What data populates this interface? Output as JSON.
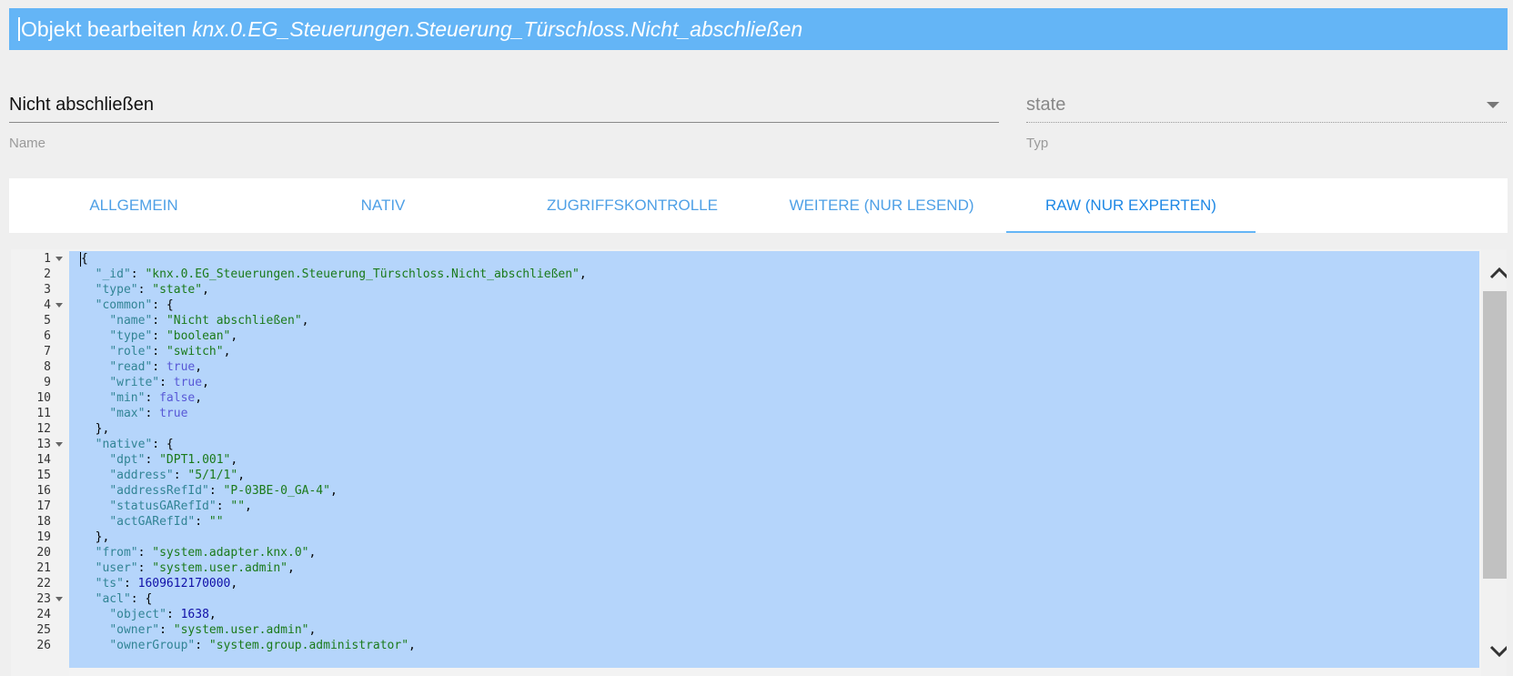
{
  "dialog": {
    "title_prefix": "Objekt bearbeiten",
    "object_id": "knx.0.EG_Steuerungen.Steuerung_Türschloss.Nicht_abschließen"
  },
  "form": {
    "name_value": "Nicht abschließen",
    "name_label": "Name",
    "type_value": "state",
    "type_label": "Typ"
  },
  "tabs": [
    {
      "label": "ALLGEMEIN",
      "active": false
    },
    {
      "label": "NATIV",
      "active": false
    },
    {
      "label": "ZUGRIFFSKONTROLLE",
      "active": false
    },
    {
      "label": "WEITERE (NUR LESEND)",
      "active": false
    },
    {
      "label": "RAW (NUR EXPERTEN)",
      "active": true
    }
  ],
  "colors": {
    "title_bar": "#64b5f6",
    "tab_text": "#4fa0e6",
    "active_tab": "#1e88e5",
    "selection": "#b5d5fb"
  },
  "editor": {
    "line_numbers": [
      "1",
      "2",
      "3",
      "4",
      "5",
      "6",
      "7",
      "8",
      "9",
      "10",
      "11",
      "12",
      "13",
      "14",
      "15",
      "16",
      "17",
      "18",
      "19",
      "20",
      "21",
      "22",
      "23",
      "24",
      "25",
      "26"
    ],
    "fold_lines": [
      "1",
      "4",
      "13",
      "23"
    ],
    "lines": [
      [
        {
          "t": "p",
          "v": "{"
        }
      ],
      [
        {
          "t": "p",
          "v": "  "
        },
        {
          "t": "k",
          "v": "\"_id\""
        },
        {
          "t": "p",
          "v": ": "
        },
        {
          "t": "s",
          "v": "\"knx.0.EG_Steuerungen.Steuerung_Türschloss.Nicht_abschließen\""
        },
        {
          "t": "p",
          "v": ","
        }
      ],
      [
        {
          "t": "p",
          "v": "  "
        },
        {
          "t": "k",
          "v": "\"type\""
        },
        {
          "t": "p",
          "v": ": "
        },
        {
          "t": "s",
          "v": "\"state\""
        },
        {
          "t": "p",
          "v": ","
        }
      ],
      [
        {
          "t": "p",
          "v": "  "
        },
        {
          "t": "k",
          "v": "\"common\""
        },
        {
          "t": "p",
          "v": ": {"
        }
      ],
      [
        {
          "t": "p",
          "v": "    "
        },
        {
          "t": "k",
          "v": "\"name\""
        },
        {
          "t": "p",
          "v": ": "
        },
        {
          "t": "s",
          "v": "\"Nicht abschließen\""
        },
        {
          "t": "p",
          "v": ","
        }
      ],
      [
        {
          "t": "p",
          "v": "    "
        },
        {
          "t": "k",
          "v": "\"type\""
        },
        {
          "t": "p",
          "v": ": "
        },
        {
          "t": "s",
          "v": "\"boolean\""
        },
        {
          "t": "p",
          "v": ","
        }
      ],
      [
        {
          "t": "p",
          "v": "    "
        },
        {
          "t": "k",
          "v": "\"role\""
        },
        {
          "t": "p",
          "v": ": "
        },
        {
          "t": "s",
          "v": "\"switch\""
        },
        {
          "t": "p",
          "v": ","
        }
      ],
      [
        {
          "t": "p",
          "v": "    "
        },
        {
          "t": "k",
          "v": "\"read\""
        },
        {
          "t": "p",
          "v": ": "
        },
        {
          "t": "b",
          "v": "true"
        },
        {
          "t": "p",
          "v": ","
        }
      ],
      [
        {
          "t": "p",
          "v": "    "
        },
        {
          "t": "k",
          "v": "\"write\""
        },
        {
          "t": "p",
          "v": ": "
        },
        {
          "t": "b",
          "v": "true"
        },
        {
          "t": "p",
          "v": ","
        }
      ],
      [
        {
          "t": "p",
          "v": "    "
        },
        {
          "t": "k",
          "v": "\"min\""
        },
        {
          "t": "p",
          "v": ": "
        },
        {
          "t": "b",
          "v": "false"
        },
        {
          "t": "p",
          "v": ","
        }
      ],
      [
        {
          "t": "p",
          "v": "    "
        },
        {
          "t": "k",
          "v": "\"max\""
        },
        {
          "t": "p",
          "v": ": "
        },
        {
          "t": "b",
          "v": "true"
        }
      ],
      [
        {
          "t": "p",
          "v": "  },"
        }
      ],
      [
        {
          "t": "p",
          "v": "  "
        },
        {
          "t": "k",
          "v": "\"native\""
        },
        {
          "t": "p",
          "v": ": {"
        }
      ],
      [
        {
          "t": "p",
          "v": "    "
        },
        {
          "t": "k",
          "v": "\"dpt\""
        },
        {
          "t": "p",
          "v": ": "
        },
        {
          "t": "s",
          "v": "\"DPT1.001\""
        },
        {
          "t": "p",
          "v": ","
        }
      ],
      [
        {
          "t": "p",
          "v": "    "
        },
        {
          "t": "k",
          "v": "\"address\""
        },
        {
          "t": "p",
          "v": ": "
        },
        {
          "t": "s",
          "v": "\"5/1/1\""
        },
        {
          "t": "p",
          "v": ","
        }
      ],
      [
        {
          "t": "p",
          "v": "    "
        },
        {
          "t": "k",
          "v": "\"addressRefId\""
        },
        {
          "t": "p",
          "v": ": "
        },
        {
          "t": "s",
          "v": "\"P-03BE-0_GA-4\""
        },
        {
          "t": "p",
          "v": ","
        }
      ],
      [
        {
          "t": "p",
          "v": "    "
        },
        {
          "t": "k",
          "v": "\"statusGARefId\""
        },
        {
          "t": "p",
          "v": ": "
        },
        {
          "t": "s",
          "v": "\"\""
        },
        {
          "t": "p",
          "v": ","
        }
      ],
      [
        {
          "t": "p",
          "v": "    "
        },
        {
          "t": "k",
          "v": "\"actGARefId\""
        },
        {
          "t": "p",
          "v": ": "
        },
        {
          "t": "s",
          "v": "\"\""
        }
      ],
      [
        {
          "t": "p",
          "v": "  },"
        }
      ],
      [
        {
          "t": "p",
          "v": "  "
        },
        {
          "t": "k",
          "v": "\"from\""
        },
        {
          "t": "p",
          "v": ": "
        },
        {
          "t": "s",
          "v": "\"system.adapter.knx.0\""
        },
        {
          "t": "p",
          "v": ","
        }
      ],
      [
        {
          "t": "p",
          "v": "  "
        },
        {
          "t": "k",
          "v": "\"user\""
        },
        {
          "t": "p",
          "v": ": "
        },
        {
          "t": "s",
          "v": "\"system.user.admin\""
        },
        {
          "t": "p",
          "v": ","
        }
      ],
      [
        {
          "t": "p",
          "v": "  "
        },
        {
          "t": "k",
          "v": "\"ts\""
        },
        {
          "t": "p",
          "v": ": "
        },
        {
          "t": "n",
          "v": "1609612170000"
        },
        {
          "t": "p",
          "v": ","
        }
      ],
      [
        {
          "t": "p",
          "v": "  "
        },
        {
          "t": "k",
          "v": "\"acl\""
        },
        {
          "t": "p",
          "v": ": {"
        }
      ],
      [
        {
          "t": "p",
          "v": "    "
        },
        {
          "t": "k",
          "v": "\"object\""
        },
        {
          "t": "p",
          "v": ": "
        },
        {
          "t": "n",
          "v": "1638"
        },
        {
          "t": "p",
          "v": ","
        }
      ],
      [
        {
          "t": "p",
          "v": "    "
        },
        {
          "t": "k",
          "v": "\"owner\""
        },
        {
          "t": "p",
          "v": ": "
        },
        {
          "t": "s",
          "v": "\"system.user.admin\""
        },
        {
          "t": "p",
          "v": ","
        }
      ],
      [
        {
          "t": "p",
          "v": "    "
        },
        {
          "t": "k",
          "v": "\"ownerGroup\""
        },
        {
          "t": "p",
          "v": ": "
        },
        {
          "t": "s",
          "v": "\"system.group.administrator\""
        },
        {
          "t": "p",
          "v": ","
        }
      ]
    ]
  },
  "scrollbar": {
    "up_icon": "chevron-up-icon",
    "down_icon": "chevron-down-icon"
  }
}
